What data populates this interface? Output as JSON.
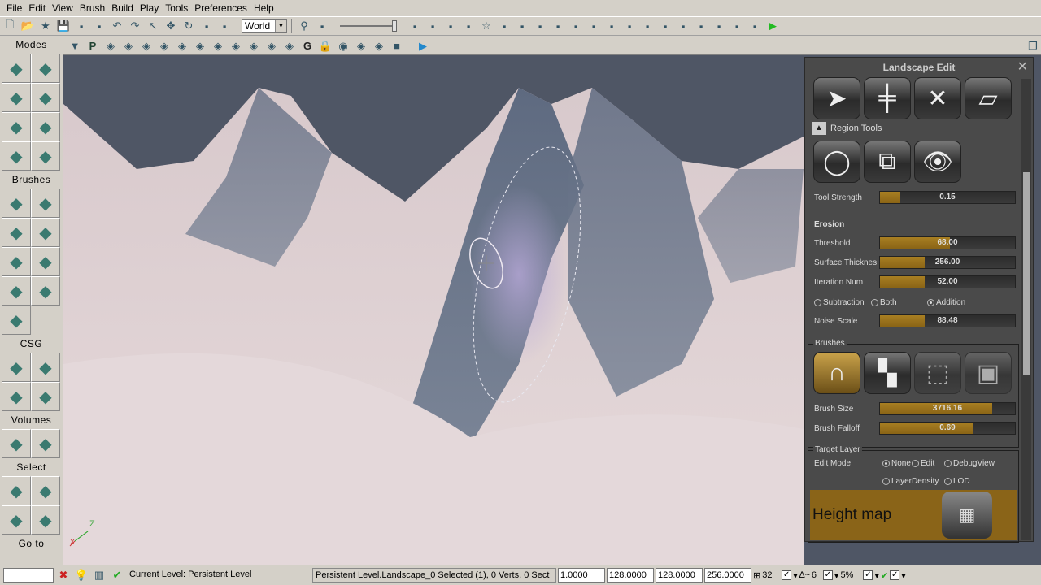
{
  "menu": [
    "File",
    "Edit",
    "View",
    "Brush",
    "Build",
    "Play",
    "Tools",
    "Preferences",
    "Help"
  ],
  "toolbar1": {
    "icons_left": [
      "new-icon",
      "open-icon",
      "favorite-icon",
      "save-icon",
      "save-all-icon",
      "save-copy-icon",
      "undo-icon",
      "redo-icon",
      "select-icon",
      "translate-icon",
      "rotate-icon",
      "scale-icon",
      "nonuniform-scale-icon"
    ],
    "coordinate_system": "World",
    "icons_right": [
      "find-icon",
      "kismet-mask-icon",
      "kismet-icon",
      "matinee-icon",
      "viewport-icon",
      "realtime-icon",
      "star-icon",
      "build-geometry-icon",
      "build-lighting-icon",
      "build-paths-icon",
      "build-paths-alt-icon",
      "build-cover-icon",
      "build-remove-icon",
      "lighting-icon",
      "screen-icon",
      "sound-icon",
      "content-browser-icon",
      "mobile-icon",
      "mobile-play-icon",
      "mobile-install-icon",
      "console-icon",
      "kismet-debug-icon",
      "play-icon"
    ]
  },
  "toolbar2": {
    "icons": [
      "dropdown-icon",
      "perspective-icon",
      "camera-pivot-icon",
      "wireframe-icon",
      "brush-wireframe-icon",
      "unlit-icon",
      "lit-icon",
      "detail-lit-icon",
      "lighting-only-icon",
      "light-complexity-icon",
      "shader-complexity-icon",
      "texture-density-icon",
      "lightmap-density-icon",
      "game-view-icon",
      "lock-icon",
      "eye-icon",
      "actor-icon",
      "actor-red-icon",
      "stop-icon",
      "play-in-viewport-icon",
      "restore-icon"
    ],
    "game_label": "G",
    "perspective_label": "P"
  },
  "modes": {
    "sections": [
      {
        "title": "Modes",
        "buttons": [
          "camera-mode-icon",
          "geometry-mode-icon",
          "terrain-mode-icon",
          "move-mode-icon",
          "texture-align-icon",
          "mesh-paint-icon",
          "landscape-icon",
          "foliage-icon"
        ]
      },
      {
        "title": "Brushes",
        "buttons": [
          "cube-icon",
          "cone-icon",
          "curved-stair-icon",
          "cylinder-icon",
          "linear-stair-icon",
          "sheet-icon",
          "spiral-stair-icon",
          "sphere-icon",
          "volumetric-icon"
        ]
      },
      {
        "title": "CSG",
        "buttons": [
          "csg-add-icon",
          "csg-subtract-icon",
          "csg-intersect-icon",
          "csg-deintersect-icon"
        ]
      },
      {
        "title": "Volumes",
        "buttons": [
          "volume-icon",
          "volume-shape-icon"
        ]
      },
      {
        "title": "Select",
        "buttons": [
          "show-selected-icon",
          "hide-selected-icon",
          "invert-selection-icon",
          "show-all-icon"
        ]
      },
      {
        "title": "Go to",
        "buttons": []
      }
    ]
  },
  "landscape": {
    "title": "Landscape Edit",
    "tool_icons": [
      "select-arrow-icon",
      "add-component-icon",
      "delete-icon",
      "region-select-icon"
    ],
    "region_tools_label": "Region Tools",
    "region_icons": [
      "lasso-icon",
      "copy-paste-icon",
      "visibility-eye-icon"
    ],
    "tool_strength": {
      "label": "Tool Strength",
      "value": "0.15",
      "fill": 0.15
    },
    "erosion_label": "Erosion",
    "threshold": {
      "label": "Threshold",
      "value": "68.00",
      "fill": 0.52
    },
    "surface": {
      "label": "Surface Thicknes",
      "value": "256.00",
      "fill": 0.33
    },
    "iteration": {
      "label": "Iteration Num",
      "value": "52.00",
      "fill": 0.33
    },
    "mode_options": [
      {
        "label": "Subtraction",
        "checked": false
      },
      {
        "label": "Both",
        "checked": false
      },
      {
        "label": "Addition",
        "checked": true
      }
    ],
    "noise": {
      "label": "Noise Scale",
      "value": "88.48",
      "fill": 0.33
    },
    "brushes_label": "Brushes",
    "brush_icons": [
      "circle-brush-icon",
      "alpha-brush-icon",
      "pattern-select-icon",
      "component-brush-icon"
    ],
    "brush_size": {
      "label": "Brush Size",
      "value": "3716.16",
      "fill": 0.83
    },
    "brush_falloff": {
      "label": "Brush Falloff",
      "value": "0.69",
      "fill": 0.69
    },
    "target_layer_label": "Target Layer",
    "edit_mode_label": "Edit Mode",
    "edit_modes": [
      {
        "label": "None",
        "checked": true
      },
      {
        "label": "Edit",
        "checked": false
      },
      {
        "label": "DebugView",
        "checked": false
      },
      {
        "label": "LayerDensity",
        "checked": false
      },
      {
        "label": "LOD",
        "checked": false
      }
    ],
    "height_map_label": "Height map",
    "accent": "#a87f22"
  },
  "status": {
    "current_level": "Current Level:  Persistent Level",
    "selection": "Persistent Level.Landscape_0 Selected (1), 0 Verts, 0 Sect",
    "fields": [
      "1.0000",
      "128.0000",
      "128.0000",
      "256.0000"
    ],
    "grid": "32",
    "rotation_snap": "6",
    "scale_snap": "5%"
  },
  "axis": {
    "z": "Z",
    "x": "X"
  }
}
